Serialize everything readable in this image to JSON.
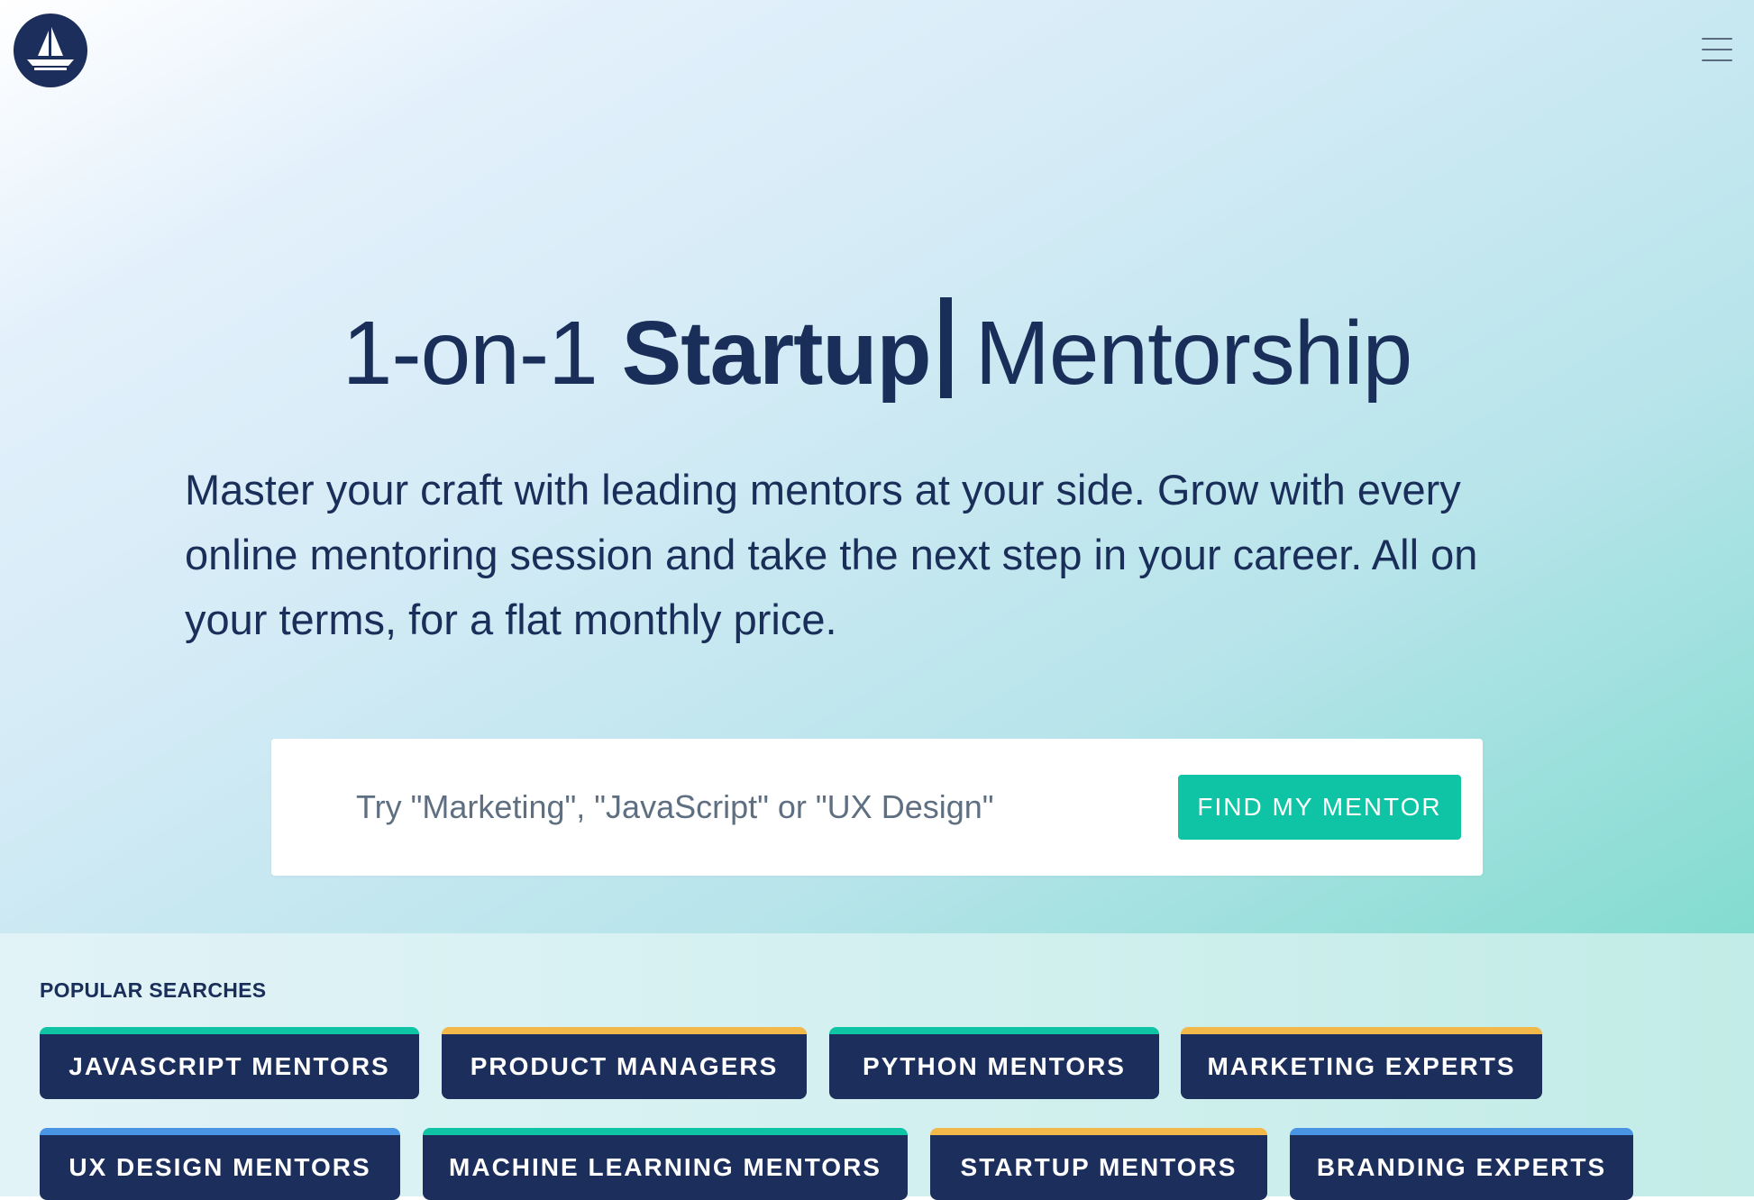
{
  "header": {
    "logo_icon": "sailboat-icon",
    "menu_icon": "hamburger-menu-icon"
  },
  "hero": {
    "headline_prefix": "1-on-1",
    "headline_bold": "Startup",
    "headline_suffix": "Mentorship",
    "subtitle": "Master your craft with leading mentors at your side. Grow with every online mentoring session and take the next step in your career. All on your terms, for a flat monthly price."
  },
  "search": {
    "placeholder": "Try \"Marketing\", \"JavaScript\" or \"UX Design\"",
    "value": "",
    "button_label": "FIND MY MENTOR"
  },
  "popular": {
    "title": "POPULAR SEARCHES",
    "tags": [
      {
        "label": "JAVASCRIPT MENTORS",
        "accent": "teal"
      },
      {
        "label": "PRODUCT MANAGERS",
        "accent": "yellow"
      },
      {
        "label": "PYTHON MENTORS",
        "accent": "teal"
      },
      {
        "label": "MARKETING EXPERTS",
        "accent": "yellow"
      },
      {
        "label": "UX DESIGN MENTORS",
        "accent": "blue"
      },
      {
        "label": "MACHINE LEARNING MENTORS",
        "accent": "teal"
      },
      {
        "label": "STARTUP MENTORS",
        "accent": "yellow"
      },
      {
        "label": "BRANDING EXPERTS",
        "accent": "blue"
      }
    ]
  },
  "colors": {
    "navy": "#1c2f5c",
    "teal": "#0ec4a4",
    "yellow": "#f2b94a",
    "blue": "#4a94e4",
    "text": "#1a2e5a"
  }
}
